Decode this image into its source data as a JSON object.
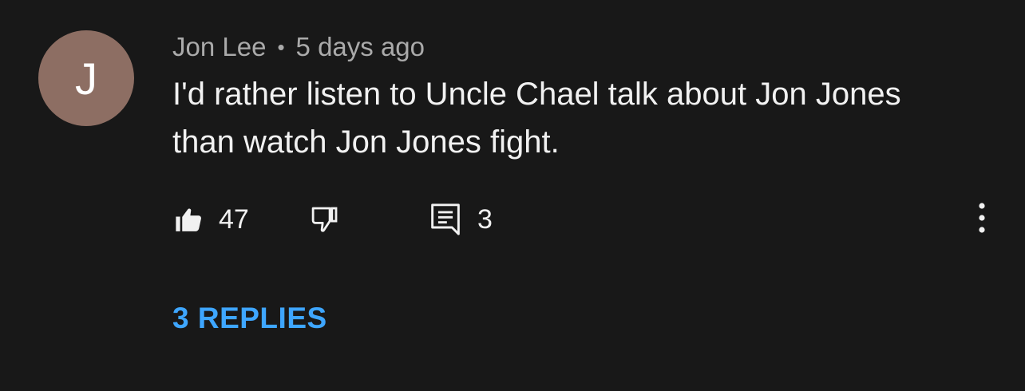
{
  "comment": {
    "avatar_initial": "J",
    "avatar_color": "#8d6e63",
    "author": "Jon Lee",
    "separator": "•",
    "timestamp": "5 days ago",
    "text": "I'd rather listen to Uncle Chael talk about Jon Jones than watch Jon Jones fight.",
    "like_count": "47",
    "reply_count": "3",
    "replies_link": "3 REPLIES",
    "icons": {
      "like": "thumbs-up-icon",
      "dislike": "thumbs-down-icon",
      "reply": "comment-icon",
      "more": "more-vertical-icon"
    },
    "colors": {
      "background": "#181818",
      "link": "#3ea6ff",
      "meta": "#aaaaaa",
      "text": "#f1f1f1"
    }
  }
}
